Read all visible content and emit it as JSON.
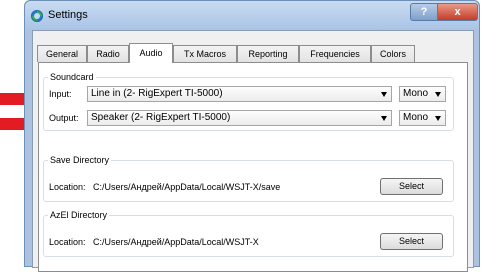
{
  "window": {
    "title": "Settings",
    "help_label": "?",
    "close_label": "x"
  },
  "tabs": [
    {
      "label": "General"
    },
    {
      "label": "Radio"
    },
    {
      "label": "Audio"
    },
    {
      "label": "Tx Macros"
    },
    {
      "label": "Reporting"
    },
    {
      "label": "Frequencies"
    },
    {
      "label": "Colors"
    }
  ],
  "active_tab": "Audio",
  "soundcard": {
    "title": "Soundcard",
    "input_label": "Input:",
    "input_device": "Line in (2- RigExpert TI-5000)",
    "input_channel": "Mono",
    "output_label": "Output:",
    "output_device": "Speaker (2- RigExpert TI-5000)",
    "output_channel": "Mono"
  },
  "save_directory": {
    "title": "Save Directory",
    "location_label": "Location:",
    "path": "C:/Users/Андрей/AppData/Local/WSJT-X/save",
    "button_label": "Select"
  },
  "azel_directory": {
    "title": "AzEl Directory",
    "location_label": "Location:",
    "path": "C:/Users/Андрей/AppData/Local/WSJT-X",
    "button_label": "Select"
  },
  "colors": {
    "highlight_arrow": "#e31b23",
    "title_bar": "#a9c4e6"
  }
}
